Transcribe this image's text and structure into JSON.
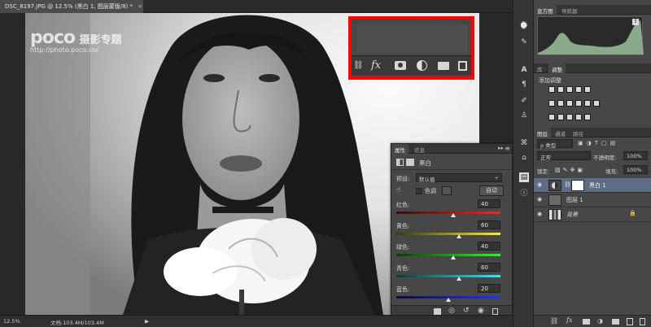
{
  "document": {
    "tab_title": "DSC_8197.JPG @ 12.5% (黑白 1, 图层蒙版/8) *",
    "close_glyph": "×"
  },
  "watermark": {
    "brand": "poco",
    "brand_cn": "摄影专题",
    "url": "http://photo.poco.cn/"
  },
  "statusbar": {
    "zoom": "12.5%",
    "doc_info": "文档:103.4M/103.4M",
    "arrow": "▶"
  },
  "overlay_bottom_icons": [
    "link-icon",
    "fx-icon",
    "mask-icon",
    "adjustment-icon",
    "folder-icon",
    "new-layer-icon"
  ],
  "overlay_fx_label": "fx",
  "histogram_panel": {
    "tabs": [
      "直方图",
      "导航器"
    ],
    "warning_glyph": "!"
  },
  "adjustments_panel": {
    "tabs": [
      "库",
      "调整"
    ],
    "title": "添加调整"
  },
  "layers_panel": {
    "tabs": [
      "图层",
      "通道",
      "路径"
    ],
    "filter_label": "ρ 类型",
    "blend_mode": "正常",
    "opacity_label": "不透明度:",
    "opacity_value": "100%",
    "lock_label": "锁定:",
    "fill_label": "填充:",
    "fill_value": "100%",
    "layers": [
      {
        "name": "黑白 1",
        "selected": true
      },
      {
        "name": "图层 1",
        "selected": false
      },
      {
        "name": "背景",
        "selected": false
      }
    ],
    "lock_glyph": "🔒"
  },
  "properties_panel": {
    "tabs": [
      "属性",
      "信息"
    ],
    "collapse_glyph": "▸▸",
    "menu_glyph": "≡",
    "type_title": "黑白",
    "preset_label": "预设:",
    "preset_value": "默认值",
    "tint_label": "色调",
    "auto_label": "自动",
    "sliders": [
      {
        "label": "红色:",
        "value": "40",
        "fraction": 0.55,
        "gradient": "linear-gradient(90deg,#3a0d0d,#ff2222)"
      },
      {
        "label": "黄色:",
        "value": "60",
        "fraction": 0.6,
        "gradient": "linear-gradient(90deg,#3a3a0d,#ffee22)"
      },
      {
        "label": "绿色:",
        "value": "40",
        "fraction": 0.55,
        "gradient": "linear-gradient(90deg,#0d3a0d,#22ff22)"
      },
      {
        "label": "青色:",
        "value": "60",
        "fraction": 0.6,
        "gradient": "linear-gradient(90deg,#0d3a3a,#22eeff)"
      },
      {
        "label": "蓝色:",
        "value": "20",
        "fraction": 0.5,
        "gradient": "linear-gradient(90deg,#0d0d3a,#2233ff)"
      }
    ]
  },
  "colors": {
    "highlight_box": "#ff0000",
    "selected_layer": "#5e6c84"
  }
}
